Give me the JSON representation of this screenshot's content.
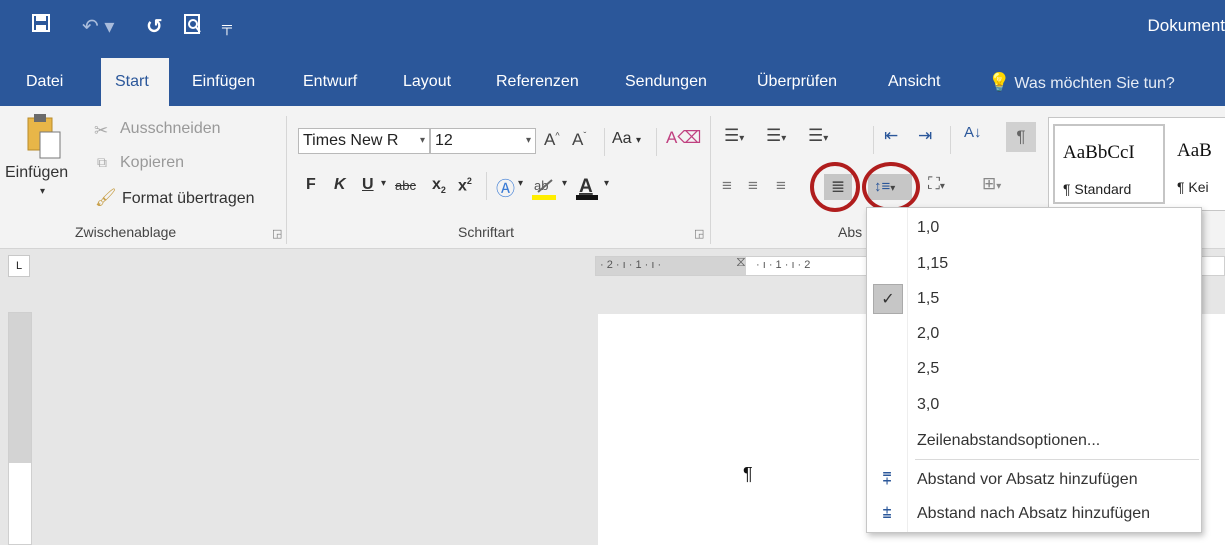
{
  "window": {
    "title": "Dokument"
  },
  "quick_access": {
    "icons": [
      "save-icon",
      "undo-icon",
      "repeat-icon",
      "print-preview-icon",
      "customize-icon"
    ]
  },
  "tabs": [
    {
      "label": "Datei"
    },
    {
      "label": "Start",
      "active": true
    },
    {
      "label": "Einfügen"
    },
    {
      "label": "Entwurf"
    },
    {
      "label": "Layout"
    },
    {
      "label": "Referenzen"
    },
    {
      "label": "Sendungen"
    },
    {
      "label": "Überprüfen"
    },
    {
      "label": "Ansicht"
    }
  ],
  "tell_me": {
    "placeholder": "Was möchten Sie tun?"
  },
  "clipboard": {
    "group_label": "Zwischenablage",
    "paste_label": "Einfügen",
    "cut_label": "Ausschneiden",
    "copy_label": "Kopieren",
    "format_painter_label": "Format übertragen"
  },
  "font": {
    "group_label": "Schriftart",
    "font_name": "Times New R",
    "font_size": "12",
    "change_case_label": "Aa",
    "bold_label": "F",
    "italic_label": "K",
    "underline_label": "U",
    "strike_label": "abc",
    "subscript_label": "x",
    "superscript_label": "x"
  },
  "paragraph": {
    "group_label": "Abs"
  },
  "styles": {
    "items": [
      {
        "sample": "AaBbCcI",
        "name": "¶ Standard"
      },
      {
        "sample": "AaB",
        "name": "¶ Kei"
      }
    ]
  },
  "ruler": {
    "corner_label": "L",
    "h_text": "· 2 · ı · 1 · ı ·",
    "h_text_right": "· ı · 1 · ı · 2"
  },
  "document": {
    "pilcrow": "¶"
  },
  "line_spacing_menu": {
    "options": [
      {
        "label": "1,0",
        "checked": false
      },
      {
        "label": "1,15",
        "checked": false
      },
      {
        "label": "1,5",
        "checked": true
      },
      {
        "label": "2,0",
        "checked": false
      },
      {
        "label": "2,5",
        "checked": false
      },
      {
        "label": "3,0",
        "checked": false
      }
    ],
    "options_label": "Zeilenabstandsoptionen...",
    "add_before_label": "Abstand vor Absatz hinzufügen",
    "add_after_label": "Abstand nach Absatz hinzufügen"
  },
  "colors": {
    "accent": "#2b579a",
    "highlight_ring": "#b01d1d"
  }
}
